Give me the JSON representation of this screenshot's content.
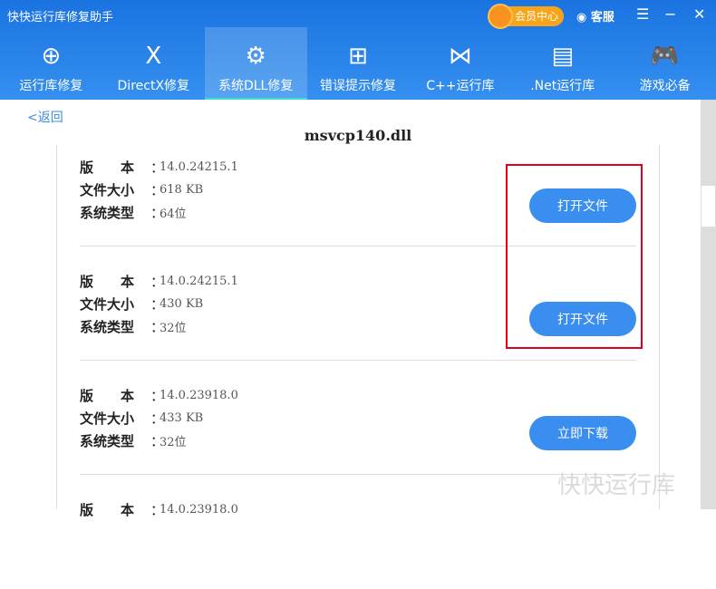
{
  "app": {
    "title": "快快运行库修复助手",
    "vip_label": "会员中心",
    "service_label": "客服",
    "menu_icon": "☰",
    "minimize_icon": "−",
    "close_icon": "✕"
  },
  "nav": [
    {
      "label": "运行库修复",
      "icon": "⊕"
    },
    {
      "label": "DirectX修复",
      "icon": "X"
    },
    {
      "label": "系统DLL修复",
      "icon": "⚙"
    },
    {
      "label": "错误提示修复",
      "icon": "⊞"
    },
    {
      "label": "C++运行库",
      "icon": "⋈"
    },
    {
      "label": ".Net运行库",
      "icon": "▤"
    },
    {
      "label": "游戏必备",
      "icon": "🎮"
    }
  ],
  "page": {
    "back": "<返回",
    "title": "msvcp140.dll"
  },
  "labels": {
    "version": "版　　本",
    "size": "文件大小",
    "type": "系统类型",
    "colon": "："
  },
  "items": [
    {
      "version": "14.0.24215.1",
      "size": "618 KB",
      "type": "64位",
      "button": "打开文件"
    },
    {
      "version": "14.0.24215.1",
      "size": "430 KB",
      "type": "32位",
      "button": "打开文件"
    },
    {
      "version": "14.0.23918.0",
      "size": "433 KB",
      "type": "32位",
      "button": "立即下载"
    },
    {
      "version": "14.0.23918.0"
    }
  ],
  "watermark": "快快运行库"
}
